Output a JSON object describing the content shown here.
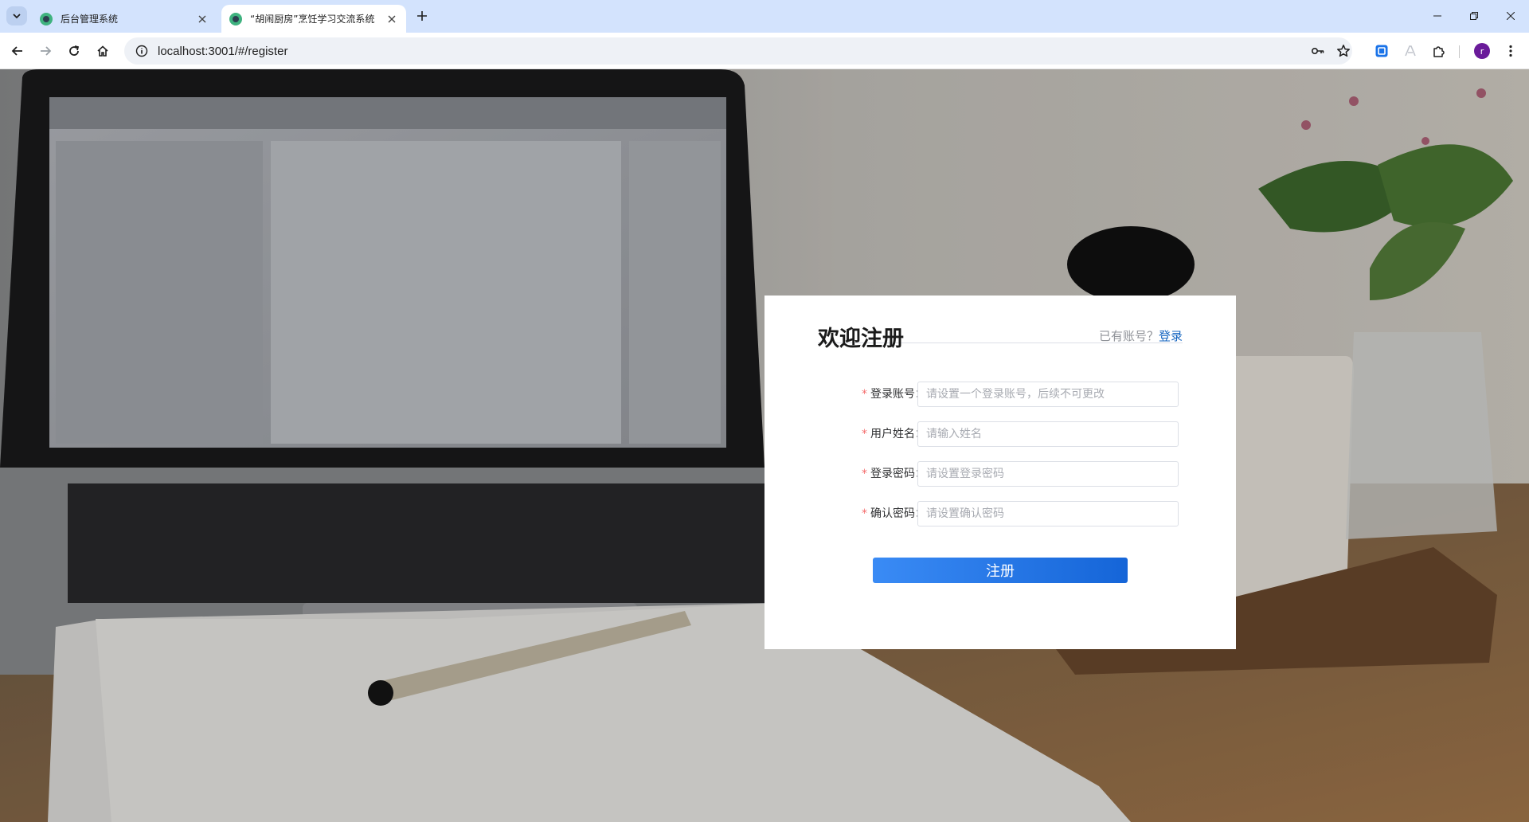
{
  "browser": {
    "tabs": [
      {
        "title": "后台管理系统",
        "active": false
      },
      {
        "title": "“胡闹厨房”烹饪学习交流系统",
        "active": true
      }
    ],
    "url": "localhost:3001/#/register",
    "profile_initial": "r"
  },
  "register": {
    "title": "欢迎注册",
    "have_account_text": "已有账号？",
    "login_link": "登录",
    "fields": [
      {
        "label": "登录账号：",
        "placeholder": "请设置一个登录账号，后续不可更改",
        "required": true
      },
      {
        "label": "用户姓名：",
        "placeholder": "请输入姓名",
        "required": true
      },
      {
        "label": "登录密码：",
        "placeholder": "请设置登录密码",
        "required": true
      },
      {
        "label": "确认密码：",
        "placeholder": "请设置确认密码",
        "required": true
      }
    ],
    "submit_label": "注册",
    "required_mark": "*"
  },
  "colors": {
    "primary": "#1565d8",
    "link": "#1565c0",
    "required": "#f56c6c"
  }
}
